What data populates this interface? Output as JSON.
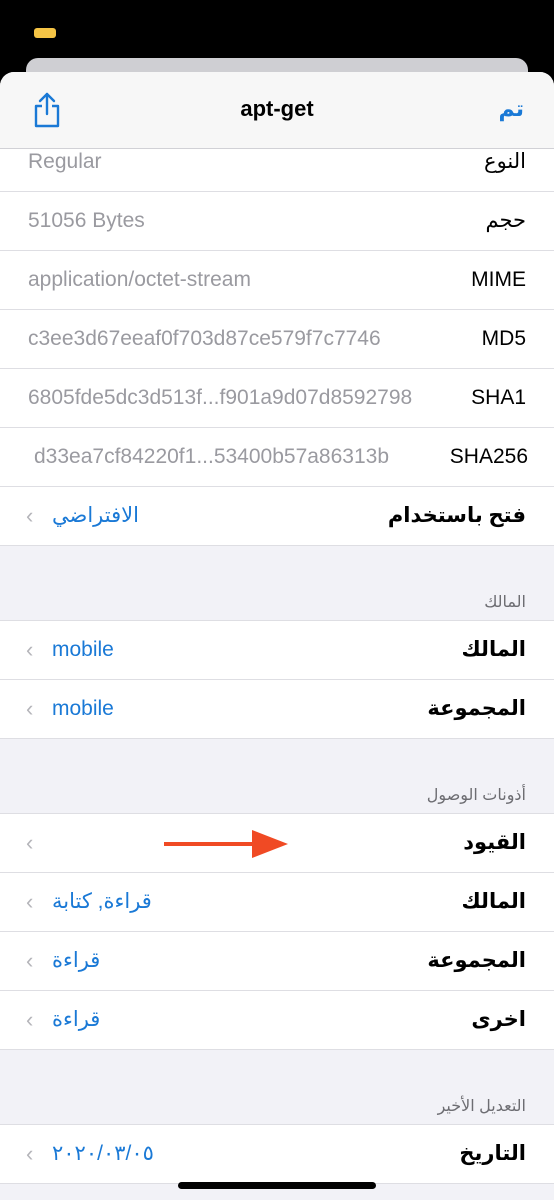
{
  "nav": {
    "title": "apt-get",
    "done_label": "تم",
    "share_icon": "share-icon"
  },
  "info_rows": [
    {
      "label": "النوع",
      "value": "Regular"
    },
    {
      "label": "حجم",
      "value": "51056 Bytes"
    },
    {
      "label": "MIME",
      "value": "application/octet-stream"
    },
    {
      "label": "MD5",
      "value": "c3ee3d67eeaf0f703d87ce579f7c7746"
    },
    {
      "label": "SHA1",
      "value": "6805fde5dc3d513f...f901a9d07d8592798"
    },
    {
      "label": "SHA256",
      "value": "d33ea7cf84220f1...53400b57a86313b"
    }
  ],
  "open_with": {
    "label": "فتح باستخدام",
    "value": "الافتراضي"
  },
  "owner_section": {
    "header": "المالك",
    "owner": {
      "label": "المالك",
      "value": "mobile"
    },
    "group": {
      "label": "المجموعة",
      "value": "mobile"
    }
  },
  "permissions_section": {
    "header": "أذونات الوصول",
    "restrictions": {
      "label": "القيود"
    },
    "owner": {
      "label": "المالك",
      "value": "قراءة, كتابة"
    },
    "group": {
      "label": "المجموعة",
      "value": "قراءة"
    },
    "other": {
      "label": "اخرى",
      "value": "قراءة"
    }
  },
  "modified_section": {
    "header": "التعديل الأخير",
    "date": {
      "label": "التاريخ",
      "value": "٢٠٢٠/٠٣/٠٥"
    }
  },
  "colors": {
    "accent": "#1a79d6",
    "annotation_arrow": "#f04a24"
  }
}
